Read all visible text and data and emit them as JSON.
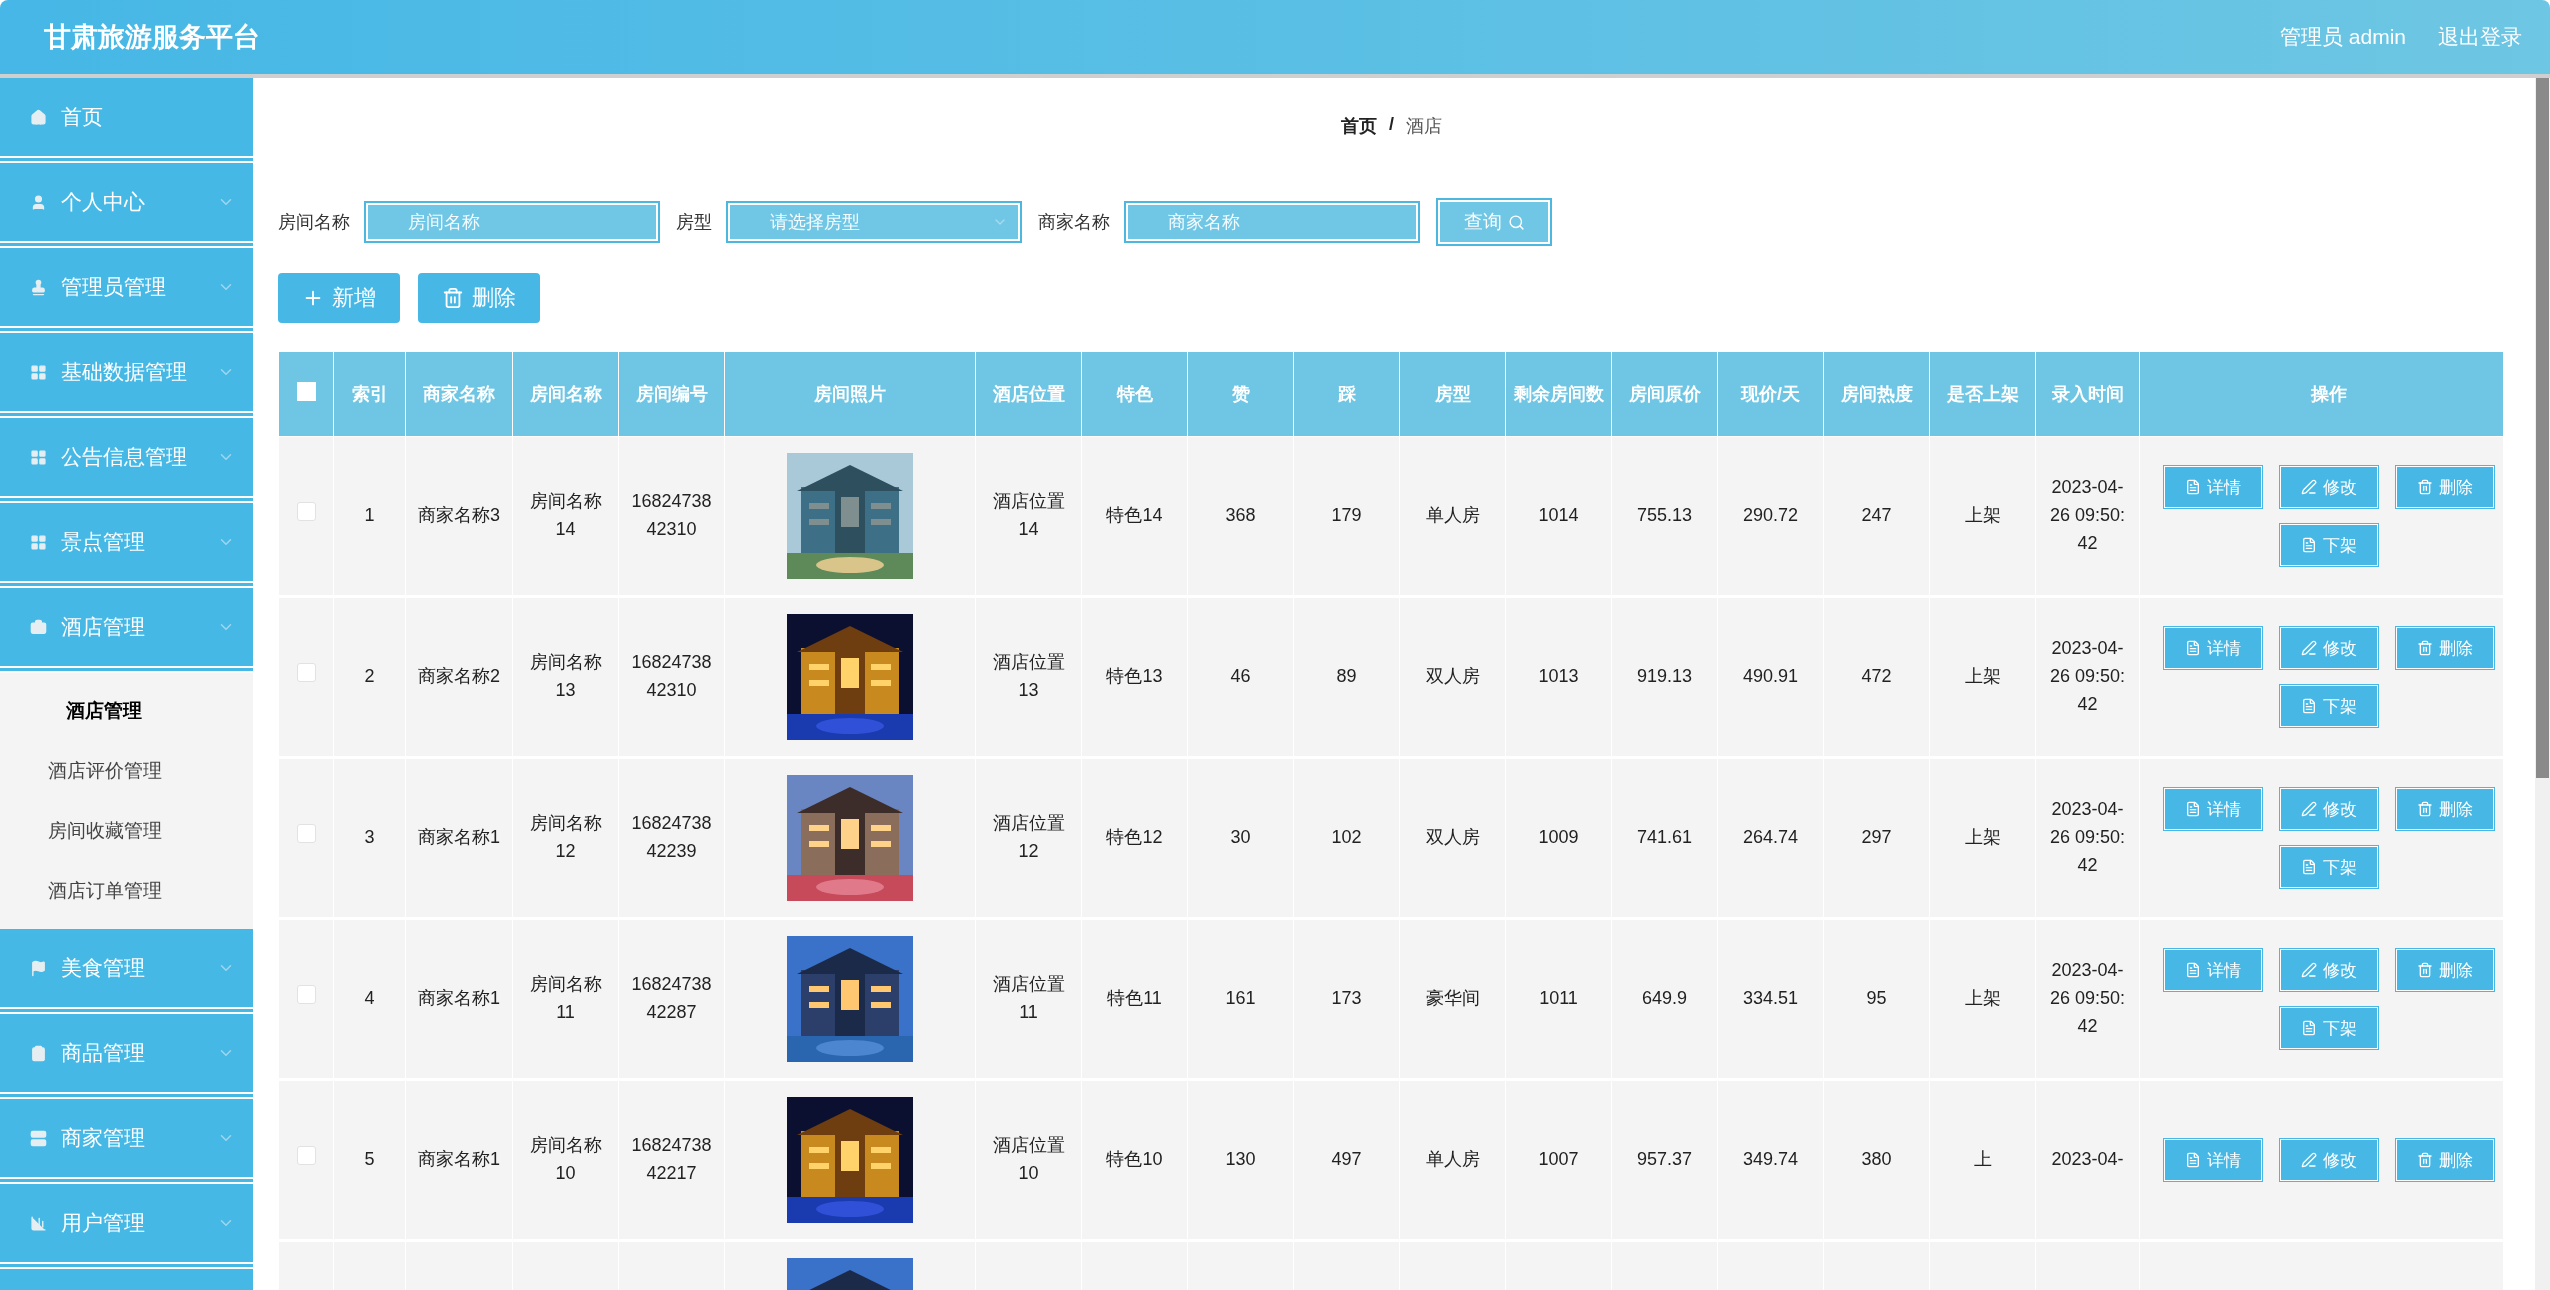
{
  "header": {
    "title": "甘肃旅游服务平台",
    "user": "管理员 admin",
    "logout": "退出登录"
  },
  "sidebar": {
    "items": [
      {
        "label": "首页",
        "has_arrow": false
      },
      {
        "label": "个人中心",
        "has_arrow": true
      },
      {
        "label": "管理员管理",
        "has_arrow": true
      },
      {
        "label": "基础数据管理",
        "has_arrow": true
      },
      {
        "label": "公告信息管理",
        "has_arrow": true
      },
      {
        "label": "景点管理",
        "has_arrow": true
      },
      {
        "label": "酒店管理",
        "has_arrow": true,
        "children": [
          {
            "label": "酒店管理",
            "selected": true
          },
          {
            "label": "酒店评价管理",
            "selected": false
          },
          {
            "label": "房间收藏管理",
            "selected": false
          },
          {
            "label": "酒店订单管理",
            "selected": false
          }
        ]
      },
      {
        "label": "美食管理",
        "has_arrow": true
      },
      {
        "label": "商品管理",
        "has_arrow": true
      },
      {
        "label": "商家管理",
        "has_arrow": true
      },
      {
        "label": "用户管理",
        "has_arrow": true
      }
    ],
    "cut_item": true
  },
  "breadcrumb": {
    "home": "首页",
    "separator": "/",
    "current": "酒店"
  },
  "filters": [
    {
      "kind": "input",
      "label": "房间名称",
      "placeholder": "房间名称"
    },
    {
      "kind": "select",
      "label": "房型",
      "placeholder": "请选择房型"
    },
    {
      "kind": "input",
      "label": "商家名称",
      "placeholder": "商家名称"
    }
  ],
  "query_button": "查询",
  "actions": [
    {
      "kind": "add",
      "label": "新增"
    },
    {
      "kind": "delete",
      "label": "删除"
    }
  ],
  "table": {
    "header_checked": false,
    "columns": [
      "索引",
      "商家名称",
      "房间名称",
      "房间编号",
      "房间照片",
      "酒店位置",
      "特色",
      "赞",
      "踩",
      "房型",
      "剩余房间数",
      "房间原价",
      "现价/天",
      "房间热度",
      "是否上架",
      "录入时间",
      "操作"
    ],
    "rows": [
      {
        "checked": false,
        "cells": [
          "1",
          "商家名称3",
          "房间名称14",
          "1682473842310"
        ],
        "photo": {
          "kind": "picture"
        },
        "cells2": [
          "酒店位置14",
          "特色14",
          "368",
          "179",
          "单人房",
          "1014",
          "755.13",
          "290.72",
          "247",
          "上架",
          "2023-04-26 09:50:42"
        ],
        "buttons": [
          {
            "kind": "detail",
            "label": "详情"
          },
          {
            "kind": "edit",
            "label": "修改"
          },
          {
            "kind": "delete",
            "label": "删除"
          },
          {
            "kind": "off",
            "label": "下架"
          }
        ]
      },
      {
        "checked": false,
        "cells": [
          "2",
          "商家名称2",
          "房间名称13",
          "1682473842310"
        ],
        "photo": {
          "kind": "picture"
        },
        "cells2": [
          "酒店位置13",
          "特色13",
          "46",
          "89",
          "双人房",
          "1013",
          "919.13",
          "490.91",
          "472",
          "上架",
          "2023-04-26 09:50:42"
        ],
        "buttons": [
          {
            "kind": "detail",
            "label": "详情"
          },
          {
            "kind": "edit",
            "label": "修改"
          },
          {
            "kind": "delete",
            "label": "删除"
          },
          {
            "kind": "off",
            "label": "下架"
          }
        ]
      },
      {
        "checked": false,
        "cells": [
          "3",
          "商家名称1",
          "房间名称12",
          "1682473842239"
        ],
        "photo": {
          "kind": "picture"
        },
        "cells2": [
          "酒店位置12",
          "特色12",
          "30",
          "102",
          "双人房",
          "1009",
          "741.61",
          "264.74",
          "297",
          "上架",
          "2023-04-26 09:50:42"
        ],
        "buttons": [
          {
            "kind": "detail",
            "label": "详情"
          },
          {
            "kind": "edit",
            "label": "修改"
          },
          {
            "kind": "delete",
            "label": "删除"
          },
          {
            "kind": "off",
            "label": "下架"
          }
        ]
      },
      {
        "checked": false,
        "cells": [
          "4",
          "商家名称1",
          "房间名称11",
          "1682473842287"
        ],
        "photo": {
          "kind": "picture"
        },
        "cells2": [
          "酒店位置11",
          "特色11",
          "161",
          "173",
          "豪华间",
          "1011",
          "649.9",
          "334.51",
          "95",
          "上架",
          "2023-04-26 09:50:42"
        ],
        "buttons": [
          {
            "kind": "detail",
            "label": "详情"
          },
          {
            "kind": "edit",
            "label": "修改"
          },
          {
            "kind": "delete",
            "label": "删除"
          },
          {
            "kind": "off",
            "label": "下架"
          }
        ]
      },
      {
        "checked": false,
        "cells": [
          "5",
          "商家名称1",
          "房间名称10",
          "1682473842217"
        ],
        "photo": {
          "kind": "picture"
        },
        "cells2": [
          "酒店位置10",
          "特色10",
          "130",
          "497",
          "单人房",
          "1007",
          "957.37",
          "349.74",
          "380",
          "上",
          "2023-04-"
        ],
        "buttons": [
          {
            "kind": "detail",
            "label": "详情"
          },
          {
            "kind": "edit",
            "label": "修改"
          },
          {
            "kind": "delete",
            "label": "删除"
          }
        ]
      }
    ],
    "partial_row": {
      "photo": {
        "kind": "picture"
      }
    }
  }
}
